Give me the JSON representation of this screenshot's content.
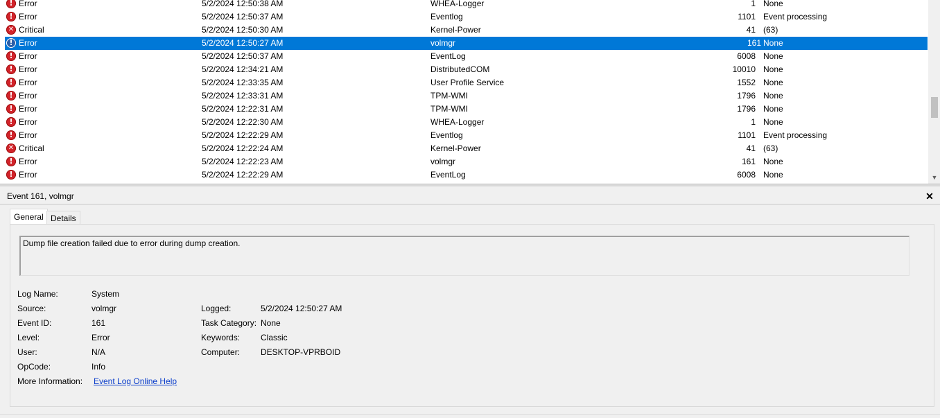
{
  "events": [
    {
      "level": "Error",
      "icon": "error",
      "date": "5/2/2024 12:50:38 AM",
      "source": "WHEA-Logger",
      "event_id": "1",
      "task": "None"
    },
    {
      "level": "Error",
      "icon": "error",
      "date": "5/2/2024 12:50:37 AM",
      "source": "Eventlog",
      "event_id": "1101",
      "task": "Event processing"
    },
    {
      "level": "Critical",
      "icon": "critical",
      "date": "5/2/2024 12:50:30 AM",
      "source": "Kernel-Power",
      "event_id": "41",
      "task": "(63)"
    },
    {
      "level": "Error",
      "icon": "error",
      "date": "5/2/2024 12:50:27 AM",
      "source": "volmgr",
      "event_id": "161",
      "task": "None",
      "selected": true
    },
    {
      "level": "Error",
      "icon": "error",
      "date": "5/2/2024 12:50:37 AM",
      "source": "EventLog",
      "event_id": "6008",
      "task": "None"
    },
    {
      "level": "Error",
      "icon": "error",
      "date": "5/2/2024 12:34:21 AM",
      "source": "DistributedCOM",
      "event_id": "10010",
      "task": "None"
    },
    {
      "level": "Error",
      "icon": "error",
      "date": "5/2/2024 12:33:35 AM",
      "source": "User Profile Service",
      "event_id": "1552",
      "task": "None"
    },
    {
      "level": "Error",
      "icon": "error",
      "date": "5/2/2024 12:33:31 AM",
      "source": "TPM-WMI",
      "event_id": "1796",
      "task": "None"
    },
    {
      "level": "Error",
      "icon": "error",
      "date": "5/2/2024 12:22:31 AM",
      "source": "TPM-WMI",
      "event_id": "1796",
      "task": "None"
    },
    {
      "level": "Error",
      "icon": "error",
      "date": "5/2/2024 12:22:30 AM",
      "source": "WHEA-Logger",
      "event_id": "1",
      "task": "None"
    },
    {
      "level": "Error",
      "icon": "error",
      "date": "5/2/2024 12:22:29 AM",
      "source": "Eventlog",
      "event_id": "1101",
      "task": "Event processing"
    },
    {
      "level": "Critical",
      "icon": "critical",
      "date": "5/2/2024 12:22:24 AM",
      "source": "Kernel-Power",
      "event_id": "41",
      "task": "(63)"
    },
    {
      "level": "Error",
      "icon": "error",
      "date": "5/2/2024 12:22:23 AM",
      "source": "volmgr",
      "event_id": "161",
      "task": "None"
    },
    {
      "level": "Error",
      "icon": "error",
      "date": "5/2/2024 12:22:29 AM",
      "source": "EventLog",
      "event_id": "6008",
      "task": "None"
    }
  ],
  "detail": {
    "title": "Event 161, volmgr",
    "close_label": "✕",
    "tabs": {
      "general": "General",
      "details": "Details"
    },
    "description": "Dump file creation failed due to error during dump creation.",
    "labels": {
      "log_name": "Log Name:",
      "source": "Source:",
      "event_id": "Event ID:",
      "level": "Level:",
      "user": "User:",
      "opcode": "OpCode:",
      "more_info": "More Information:",
      "logged": "Logged:",
      "task_category": "Task Category:",
      "keywords": "Keywords:",
      "computer": "Computer:"
    },
    "values": {
      "log_name": "System",
      "source": "volmgr",
      "event_id": "161",
      "level": "Error",
      "user": "N/A",
      "opcode": "Info",
      "more_info_link": "Event Log Online Help",
      "logged": "5/2/2024 12:50:27 AM",
      "task_category": "None",
      "keywords": "Classic",
      "computer": "DESKTOP-VPRBOID"
    }
  },
  "icons": {
    "error": "error-icon",
    "critical": "critical-icon",
    "close": "close-icon"
  },
  "colors": {
    "selection": "#0078d7",
    "error": "#d2232a",
    "link": "#0b3ecb"
  }
}
